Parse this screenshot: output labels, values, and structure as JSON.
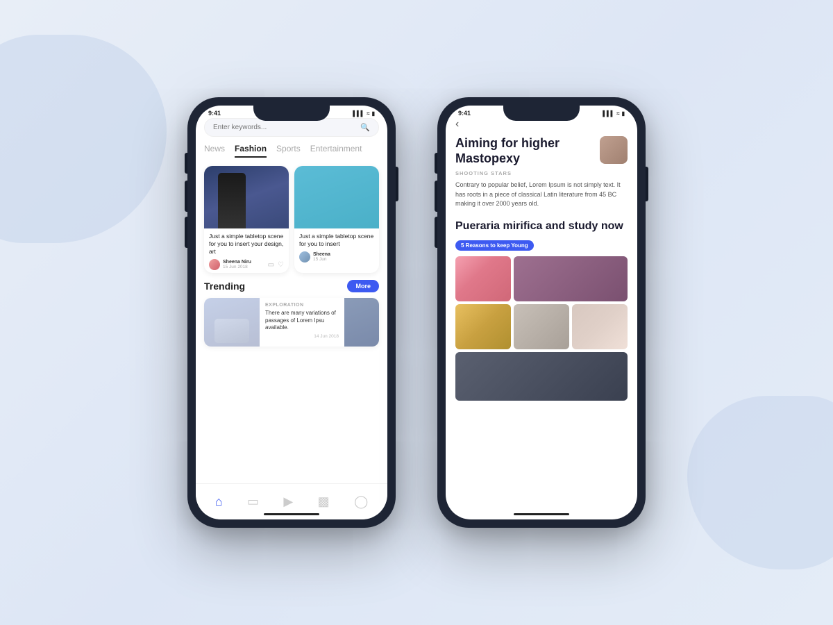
{
  "background": {
    "color": "#e8eef7"
  },
  "phone1": {
    "status_bar": {
      "time": "9:41",
      "signal": "▌▌▌",
      "wifi": "WiFi",
      "battery": "🔋"
    },
    "search": {
      "placeholder": "Enter keywords..."
    },
    "categories": [
      {
        "label": "News",
        "active": false
      },
      {
        "label": "Fashion",
        "active": true
      },
      {
        "label": "Sports",
        "active": false
      },
      {
        "label": "Entertainment",
        "active": false
      }
    ],
    "articles": [
      {
        "title": "Just a simple tabletop scene for you to insert your design, art",
        "author": "Sheena Niru",
        "date": "15 Jun 2018"
      },
      {
        "title": "Just a simple tabletop scene for you to insert",
        "author": "Sheena",
        "date": "15 Jun"
      }
    ],
    "trending": {
      "title": "Trending",
      "more_label": "More",
      "card": {
        "category": "EXPLORATION",
        "text": "There are many variations of passages of Lorem Ipsu available.",
        "date": "14 Jun 2018"
      }
    },
    "nav": {
      "items": [
        "home",
        "book",
        "play",
        "bookmark",
        "person"
      ]
    }
  },
  "phone2": {
    "status_bar": {
      "time": "9:41",
      "signal": "▌▌▌",
      "wifi": "WiFi",
      "battery": "🔋"
    },
    "back_label": "‹",
    "article": {
      "title": "Aiming for higher Mastopexy",
      "category": "SHOOTING STARS",
      "excerpt": "Contrary to popular belief, Lorem Ipsum is not simply text. It has roots in a piece of classical Latin literature from 45 BC making it over 2000 years old."
    },
    "section": {
      "title": "Pueraria mirifica and study now",
      "badge": "5 Reasons to keep Young",
      "photos": [
        "woman-flowers",
        "woman-red-hair",
        "woman-hat",
        "woman-coat",
        "woman-closeup",
        "man-portrait-wide"
      ]
    }
  }
}
